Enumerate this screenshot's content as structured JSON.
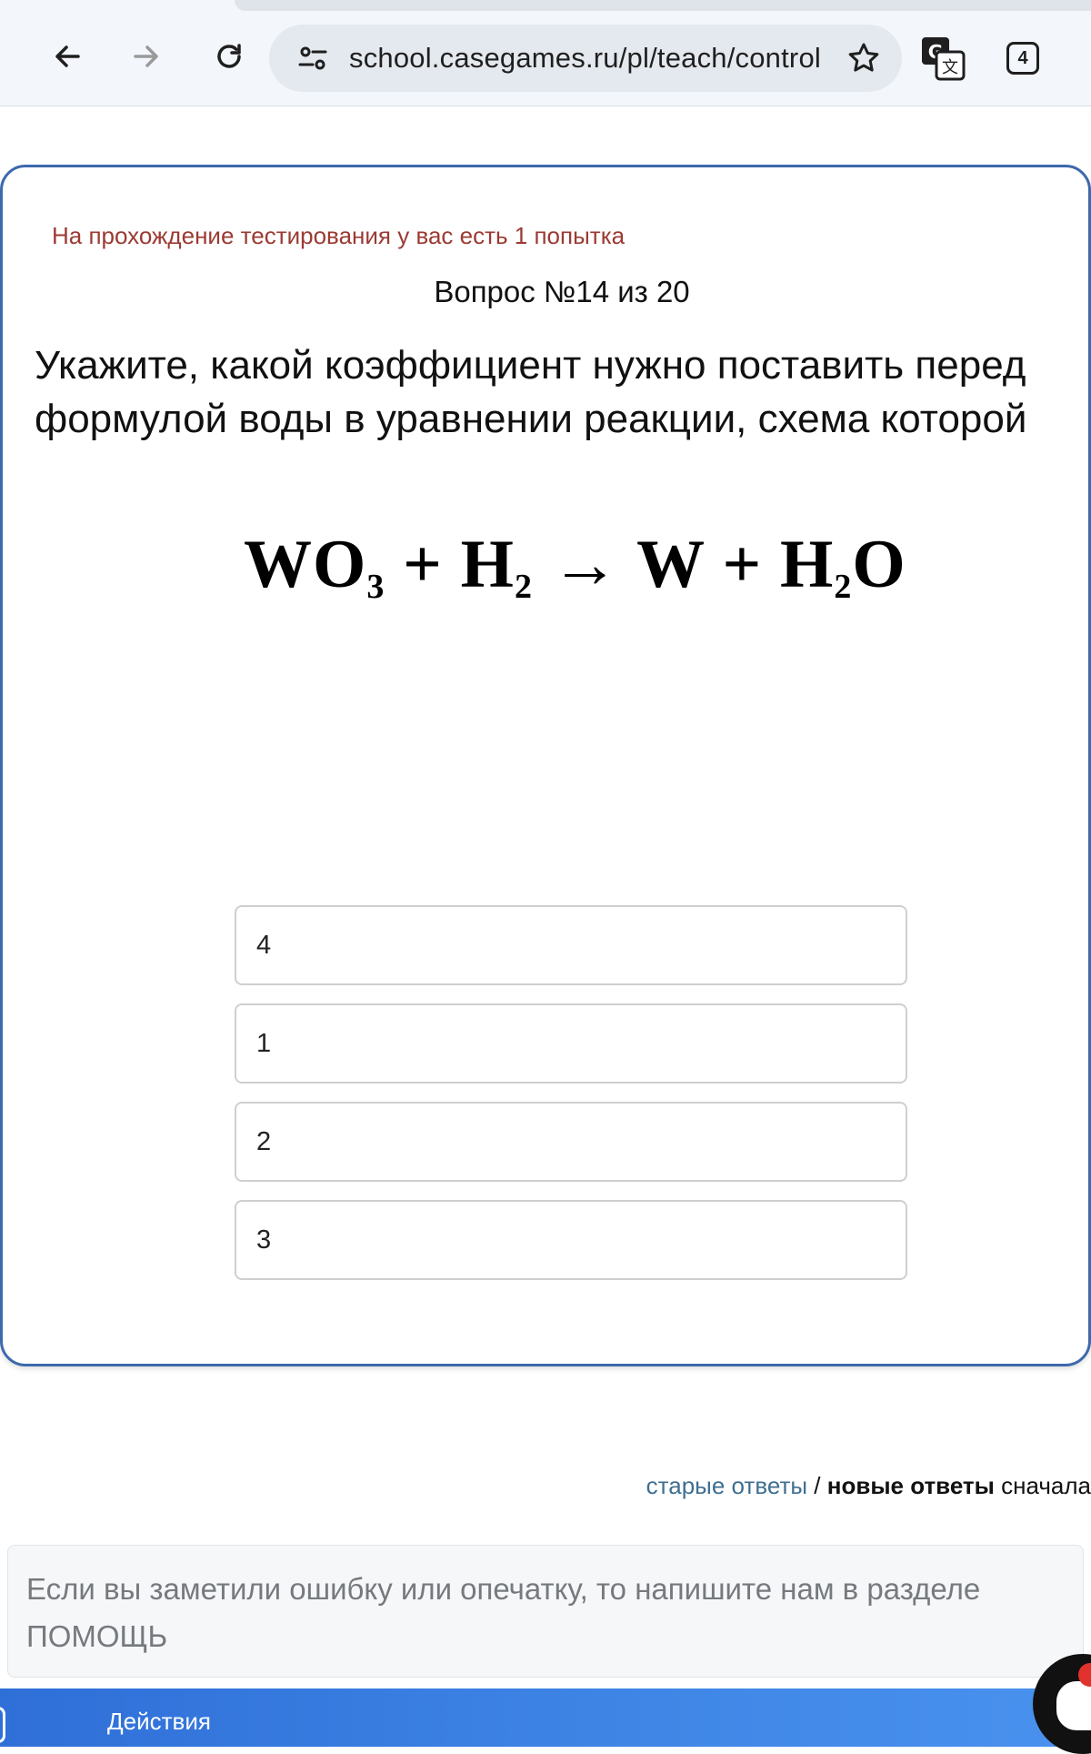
{
  "browser": {
    "url": "school.casegames.ru/pl/teach/control",
    "tab_count": "4",
    "icons": [
      "back-arrow-icon",
      "forward-arrow-icon",
      "reload-icon",
      "site-info-icon",
      "star-icon",
      "translate-icon",
      "tabs-icon"
    ]
  },
  "test": {
    "attempts_note": "На прохождение тестирования у вас есть 1 попытка",
    "question_counter": "Вопрос №14 из 20",
    "question_text": "Укажите, какой коэффициент нужно поставить перед формулой воды в уравнении реакции, схема которой",
    "formula": {
      "wo": "WO",
      "wo_sub": "3",
      "plus1": "+",
      "h": "H",
      "h_sub": "2",
      "arrow": "→",
      "w": "W",
      "plus2": "+",
      "h2o_h": "H",
      "h2o_sub": "2",
      "h2o_o": "O"
    },
    "options": [
      {
        "label": "4"
      },
      {
        "label": "1"
      },
      {
        "label": "2"
      },
      {
        "label": "3"
      }
    ]
  },
  "answers_sort": {
    "old": "старые ответы",
    "separator": "/",
    "new": "новые ответы",
    "suffix": "сначала"
  },
  "help_box": {
    "text": "Если вы заметили ошибку или опечатку, то напишите нам в разделе ПОМОЩЬ"
  },
  "bottom_bar": {
    "actions_label": "Действия"
  },
  "colors": {
    "card_border": "#3d69ad",
    "attempts_note": "#9b3a33",
    "old_answers_link": "#3f6f91",
    "bottom_bar": "#2f6fd8"
  }
}
